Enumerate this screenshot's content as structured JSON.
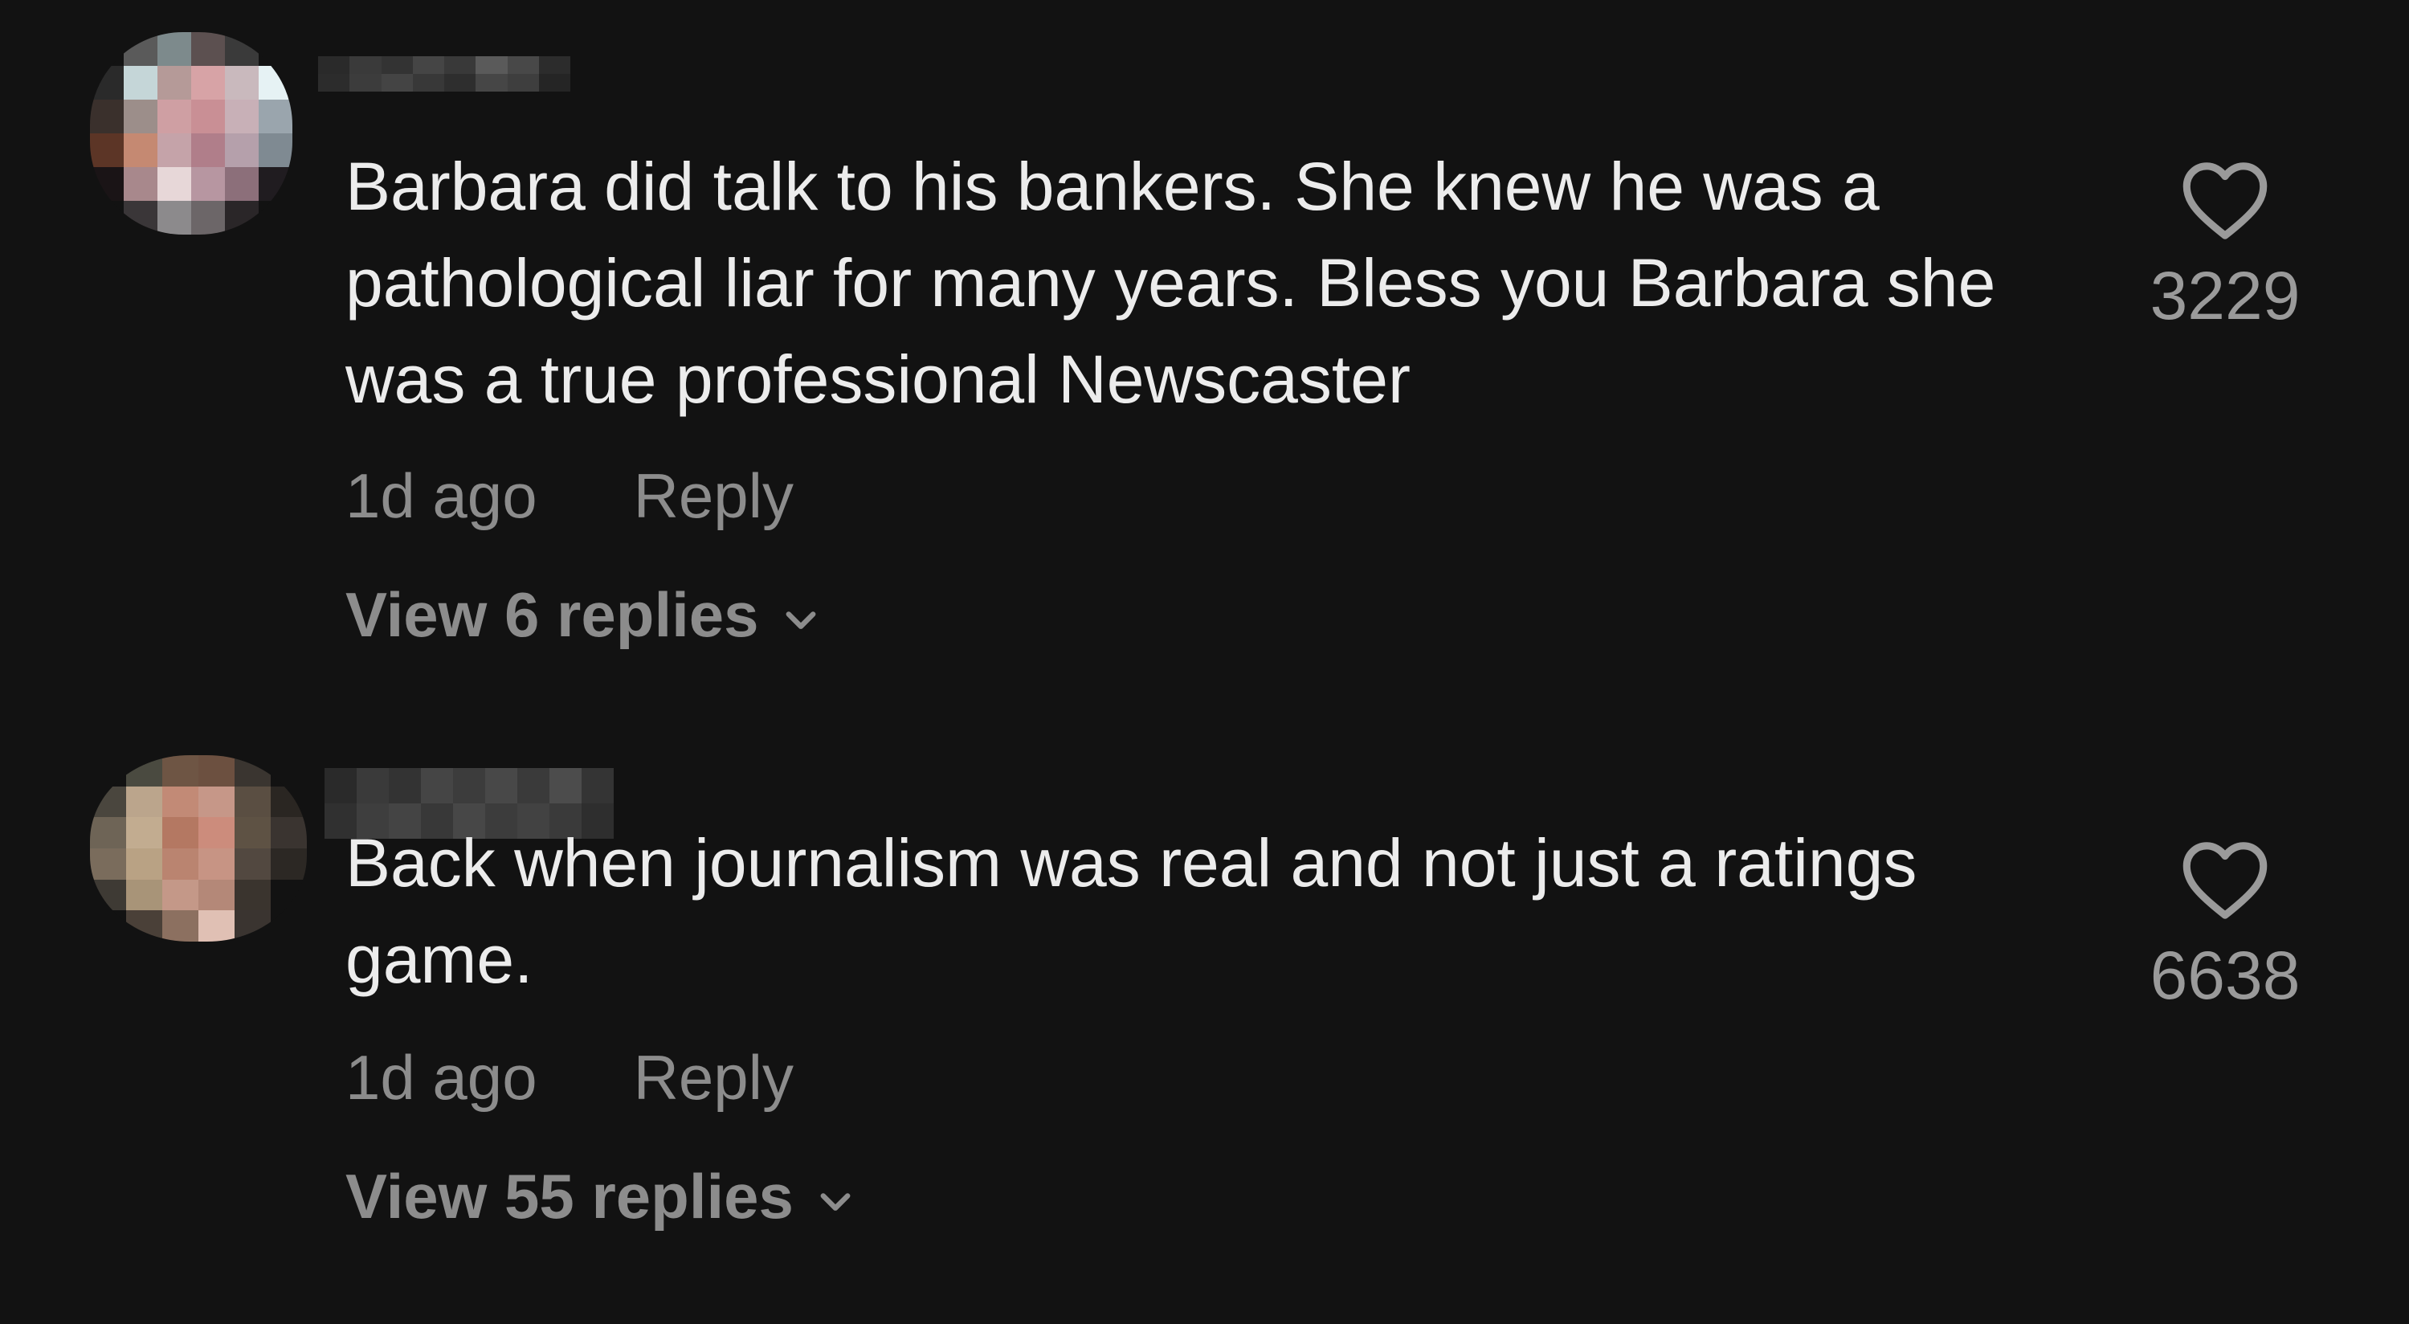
{
  "comments": [
    {
      "text": "Barbara did talk to his bankers. She knew he was a pathological liar for many years. Bless you Barbara she was a true professional Newscaster",
      "time": "1d ago",
      "reply_label": "Reply",
      "view_replies": "View 6 replies",
      "likes": "3229"
    },
    {
      "text": "Back when journalism was real and not just a ratings game.",
      "time": "1d ago",
      "reply_label": "Reply",
      "view_replies": "View 55 replies",
      "likes": "6638"
    }
  ],
  "icons": {
    "like": "heart-outline-icon",
    "expand": "chevron-down-icon"
  },
  "colors": {
    "background": "#121212",
    "primary_text": "#ececec",
    "secondary_text": "#8c8c8c"
  }
}
